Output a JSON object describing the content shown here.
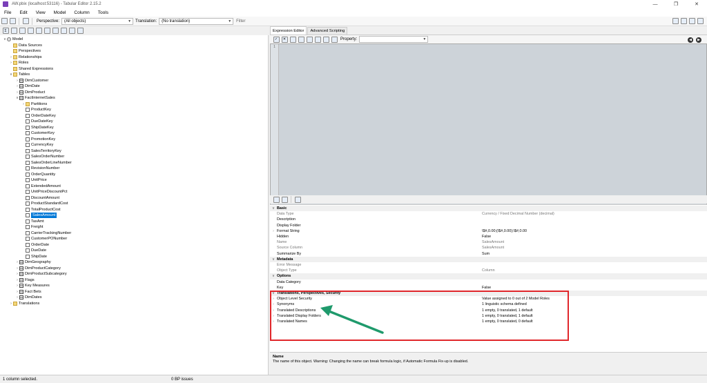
{
  "window": {
    "title": "AW.pbix (localhost:53116) - Tabular Editor 2.15.2"
  },
  "menu": [
    "File",
    "Edit",
    "View",
    "Model",
    "Column",
    "Tools"
  ],
  "toolbar": {
    "perspective_label": "Perspective:",
    "perspective_value": "(All objects)",
    "translation_label": "Translation:",
    "translation_value": "(No translation)",
    "filter_placeholder": "Filter"
  },
  "tree": [
    {
      "label": "Model",
      "icon": "model-icon",
      "level": 0,
      "exp": "v"
    },
    {
      "label": "Data Sources",
      "icon": "folder-icon",
      "level": 1,
      "exp": ""
    },
    {
      "label": "Perspectives",
      "icon": "folder-icon",
      "level": 1,
      "exp": ""
    },
    {
      "label": "Relationships",
      "icon": "folder-icon",
      "level": 1,
      "exp": ">"
    },
    {
      "label": "Roles",
      "icon": "folder-icon",
      "level": 1,
      "exp": ">"
    },
    {
      "label": "Shared Expressions",
      "icon": "folder-icon",
      "level": 1,
      "exp": ""
    },
    {
      "label": "Tables",
      "icon": "folder-icon",
      "level": 1,
      "exp": "v"
    },
    {
      "label": "DimCustomer",
      "icon": "table-icon",
      "level": 2,
      "exp": ">"
    },
    {
      "label": "DimDate",
      "icon": "table-icon",
      "level": 2,
      "exp": ">"
    },
    {
      "label": "DimProduct",
      "icon": "table-icon",
      "level": 2,
      "exp": ">"
    },
    {
      "label": "FactInternetSales",
      "icon": "table-icon",
      "level": 2,
      "exp": "v"
    },
    {
      "label": "Partitions",
      "icon": "folder-icon",
      "level": 3,
      "exp": ">"
    },
    {
      "label": "ProductKey",
      "icon": "column-icon",
      "level": 3,
      "exp": ""
    },
    {
      "label": "OrderDateKey",
      "icon": "column-icon",
      "level": 3,
      "exp": ""
    },
    {
      "label": "DueDateKey",
      "icon": "column-icon",
      "level": 3,
      "exp": ""
    },
    {
      "label": "ShipDateKey",
      "icon": "column-icon",
      "level": 3,
      "exp": ""
    },
    {
      "label": "CustomerKey",
      "icon": "column-icon",
      "level": 3,
      "exp": ""
    },
    {
      "label": "PromotionKey",
      "icon": "column-icon",
      "level": 3,
      "exp": ""
    },
    {
      "label": "CurrencyKey",
      "icon": "column-icon",
      "level": 3,
      "exp": ""
    },
    {
      "label": "SalesTerritoryKey",
      "icon": "column-icon",
      "level": 3,
      "exp": ""
    },
    {
      "label": "SalesOrderNumber",
      "icon": "column-icon",
      "level": 3,
      "exp": ""
    },
    {
      "label": "SalesOrderLineNumber",
      "icon": "column-icon",
      "level": 3,
      "exp": ""
    },
    {
      "label": "RevisionNumber",
      "icon": "column-icon",
      "level": 3,
      "exp": ""
    },
    {
      "label": "OrderQuantity",
      "icon": "column-icon",
      "level": 3,
      "exp": ""
    },
    {
      "label": "UnitPrice",
      "icon": "column-icon",
      "level": 3,
      "exp": ""
    },
    {
      "label": "ExtendedAmount",
      "icon": "column-icon",
      "level": 3,
      "exp": ""
    },
    {
      "label": "UnitPriceDiscountPct",
      "icon": "column-icon",
      "level": 3,
      "exp": ""
    },
    {
      "label": "DiscountAmount",
      "icon": "column-icon",
      "level": 3,
      "exp": ""
    },
    {
      "label": "ProductStandardCost",
      "icon": "column-icon",
      "level": 3,
      "exp": ""
    },
    {
      "label": "TotalProductCost",
      "icon": "column-icon",
      "level": 3,
      "exp": ""
    },
    {
      "label": "SalesAmount",
      "icon": "column-icon",
      "level": 3,
      "exp": "",
      "selected": true
    },
    {
      "label": "TaxAmt",
      "icon": "column-icon",
      "level": 3,
      "exp": ""
    },
    {
      "label": "Freight",
      "icon": "column-icon",
      "level": 3,
      "exp": ""
    },
    {
      "label": "CarrierTrackingNumber",
      "icon": "column-icon",
      "level": 3,
      "exp": ""
    },
    {
      "label": "CustomerPONumber",
      "icon": "column-icon",
      "level": 3,
      "exp": ""
    },
    {
      "label": "OrderDate",
      "icon": "column-icon",
      "level": 3,
      "exp": ""
    },
    {
      "label": "DueDate",
      "icon": "column-icon",
      "level": 3,
      "exp": ""
    },
    {
      "label": "ShipDate",
      "icon": "column-icon",
      "level": 3,
      "exp": ""
    },
    {
      "label": "DimGeography",
      "icon": "table-icon",
      "level": 2,
      "exp": ">"
    },
    {
      "label": "DimProductCategory",
      "icon": "table-icon",
      "level": 2,
      "exp": ">"
    },
    {
      "label": "DimProductSubcategory",
      "icon": "table-icon",
      "level": 2,
      "exp": ">"
    },
    {
      "label": "Flags",
      "icon": "table-icon",
      "level": 2,
      "exp": ">"
    },
    {
      "label": "Key Measures",
      "icon": "table-icon",
      "level": 2,
      "exp": ">"
    },
    {
      "label": "Fact Bets",
      "icon": "table-icon",
      "level": 2,
      "exp": ">"
    },
    {
      "label": "DimDates",
      "icon": "table-icon",
      "level": 2,
      "exp": ">"
    },
    {
      "label": "Translations",
      "icon": "folder-icon",
      "level": 1,
      "exp": ">"
    }
  ],
  "tabs": [
    "Expression Editor",
    "Advanced Scripting"
  ],
  "editor": {
    "line_number": "1",
    "property_label": "Property:"
  },
  "properties": [
    {
      "type": "cat",
      "name": "Basic"
    },
    {
      "name": "Data Type",
      "value": "Currency / Fixed Decimal Number (decimal)",
      "dim": true
    },
    {
      "name": "Description",
      "value": ""
    },
    {
      "name": "Display Folder",
      "value": ""
    },
    {
      "name": "Format String",
      "value": "\\$#,0.00;(\\$#,0.00);\\$#,0.00",
      "exp": true
    },
    {
      "name": "Hidden",
      "value": "False"
    },
    {
      "name": "Name",
      "value": "SalesAmount",
      "dim": true
    },
    {
      "name": "Source Column",
      "value": "SalesAmount",
      "dim": true
    },
    {
      "name": "Summarize By",
      "value": "Sum"
    },
    {
      "type": "cat",
      "name": "Metadata"
    },
    {
      "name": "Error Message",
      "value": "",
      "dim": true
    },
    {
      "name": "Object Type",
      "value": "Column",
      "dim": true
    },
    {
      "type": "cat",
      "name": "Options"
    },
    {
      "name": "Data Category",
      "value": ""
    },
    {
      "name": "Key",
      "value": "False"
    },
    {
      "type": "cat",
      "name": "Translations, Perspectives, Security"
    },
    {
      "name": "Object Level Security",
      "value": "Value assigned to 0 out of 2 Model Roles",
      "exp": true
    },
    {
      "name": "Synonyms",
      "value": "1 linguistic schema defined",
      "exp": true
    },
    {
      "name": "Translated Descriptions",
      "value": "1 empty, 0 translated, 1 default",
      "exp": true
    },
    {
      "name": "Translated Display Folders",
      "value": "1 empty, 0 translated, 1 default",
      "exp": true
    },
    {
      "name": "Translated Names",
      "value": "1 empty, 0 translated, 0 default",
      "exp": true
    }
  ],
  "description": {
    "title": "Name",
    "text": "The name of this object. Warning: Changing the name can break formula logic, if Automatic Formula Fix-up is disabled."
  },
  "status": {
    "left": "1 column selected.",
    "bp": "0 BP issues"
  },
  "colors": {
    "selection": "#0078d7",
    "highlight_box": "#e0262a",
    "annotation_arrow": "#1f9a6c"
  }
}
